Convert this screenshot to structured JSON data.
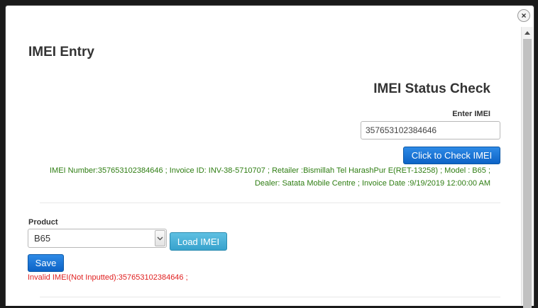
{
  "dialog": {
    "title": "IMEI Entry",
    "close_glyph": "×",
    "close_icon": "close-icon"
  },
  "status_check": {
    "title": "IMEI Status Check",
    "imei_label": "Enter IMEI",
    "imei_value": "357653102384646",
    "check_button_label": "Click to Check IMEI",
    "result_line_1": "IMEI Number:357653102384646 ; Invoice ID: INV-38-5710707 ; Retailer :Bismillah Tel HarashPur E(RET-13258) ; Model : B65 ;",
    "result_line_2": "Dealer: Satata Mobile Centre ; Invoice Date :9/19/2019 12:00:00 AM",
    "result_color": "#2e7d12"
  },
  "product": {
    "label": "Product",
    "selected_value": "B65",
    "load_button_label": "Load IMEI"
  },
  "save_button_label": "Save",
  "error_message": "Invalid IMEI(Not Inputted):357653102384646 ;",
  "colors": {
    "primary_button": "#0d63c6",
    "info_button": "#37a2cd",
    "error": "#e02020",
    "success": "#2e7d12"
  }
}
